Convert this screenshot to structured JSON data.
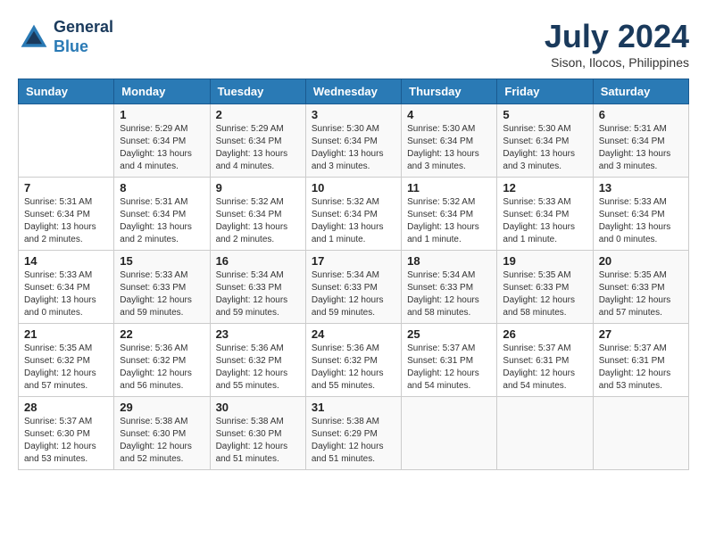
{
  "header": {
    "logo_line1": "General",
    "logo_line2": "Blue",
    "month_title": "July 2024",
    "location": "Sison, Ilocos, Philippines"
  },
  "weekdays": [
    "Sunday",
    "Monday",
    "Tuesday",
    "Wednesday",
    "Thursday",
    "Friday",
    "Saturday"
  ],
  "weeks": [
    [
      {
        "day": "",
        "info": ""
      },
      {
        "day": "1",
        "info": "Sunrise: 5:29 AM\nSunset: 6:34 PM\nDaylight: 13 hours\nand 4 minutes."
      },
      {
        "day": "2",
        "info": "Sunrise: 5:29 AM\nSunset: 6:34 PM\nDaylight: 13 hours\nand 4 minutes."
      },
      {
        "day": "3",
        "info": "Sunrise: 5:30 AM\nSunset: 6:34 PM\nDaylight: 13 hours\nand 3 minutes."
      },
      {
        "day": "4",
        "info": "Sunrise: 5:30 AM\nSunset: 6:34 PM\nDaylight: 13 hours\nand 3 minutes."
      },
      {
        "day": "5",
        "info": "Sunrise: 5:30 AM\nSunset: 6:34 PM\nDaylight: 13 hours\nand 3 minutes."
      },
      {
        "day": "6",
        "info": "Sunrise: 5:31 AM\nSunset: 6:34 PM\nDaylight: 13 hours\nand 3 minutes."
      }
    ],
    [
      {
        "day": "7",
        "info": "Sunrise: 5:31 AM\nSunset: 6:34 PM\nDaylight: 13 hours\nand 2 minutes."
      },
      {
        "day": "8",
        "info": "Sunrise: 5:31 AM\nSunset: 6:34 PM\nDaylight: 13 hours\nand 2 minutes."
      },
      {
        "day": "9",
        "info": "Sunrise: 5:32 AM\nSunset: 6:34 PM\nDaylight: 13 hours\nand 2 minutes."
      },
      {
        "day": "10",
        "info": "Sunrise: 5:32 AM\nSunset: 6:34 PM\nDaylight: 13 hours\nand 1 minute."
      },
      {
        "day": "11",
        "info": "Sunrise: 5:32 AM\nSunset: 6:34 PM\nDaylight: 13 hours\nand 1 minute."
      },
      {
        "day": "12",
        "info": "Sunrise: 5:33 AM\nSunset: 6:34 PM\nDaylight: 13 hours\nand 1 minute."
      },
      {
        "day": "13",
        "info": "Sunrise: 5:33 AM\nSunset: 6:34 PM\nDaylight: 13 hours\nand 0 minutes."
      }
    ],
    [
      {
        "day": "14",
        "info": "Sunrise: 5:33 AM\nSunset: 6:34 PM\nDaylight: 13 hours\nand 0 minutes."
      },
      {
        "day": "15",
        "info": "Sunrise: 5:33 AM\nSunset: 6:33 PM\nDaylight: 12 hours\nand 59 minutes."
      },
      {
        "day": "16",
        "info": "Sunrise: 5:34 AM\nSunset: 6:33 PM\nDaylight: 12 hours\nand 59 minutes."
      },
      {
        "day": "17",
        "info": "Sunrise: 5:34 AM\nSunset: 6:33 PM\nDaylight: 12 hours\nand 59 minutes."
      },
      {
        "day": "18",
        "info": "Sunrise: 5:34 AM\nSunset: 6:33 PM\nDaylight: 12 hours\nand 58 minutes."
      },
      {
        "day": "19",
        "info": "Sunrise: 5:35 AM\nSunset: 6:33 PM\nDaylight: 12 hours\nand 58 minutes."
      },
      {
        "day": "20",
        "info": "Sunrise: 5:35 AM\nSunset: 6:33 PM\nDaylight: 12 hours\nand 57 minutes."
      }
    ],
    [
      {
        "day": "21",
        "info": "Sunrise: 5:35 AM\nSunset: 6:32 PM\nDaylight: 12 hours\nand 57 minutes."
      },
      {
        "day": "22",
        "info": "Sunrise: 5:36 AM\nSunset: 6:32 PM\nDaylight: 12 hours\nand 56 minutes."
      },
      {
        "day": "23",
        "info": "Sunrise: 5:36 AM\nSunset: 6:32 PM\nDaylight: 12 hours\nand 55 minutes."
      },
      {
        "day": "24",
        "info": "Sunrise: 5:36 AM\nSunset: 6:32 PM\nDaylight: 12 hours\nand 55 minutes."
      },
      {
        "day": "25",
        "info": "Sunrise: 5:37 AM\nSunset: 6:31 PM\nDaylight: 12 hours\nand 54 minutes."
      },
      {
        "day": "26",
        "info": "Sunrise: 5:37 AM\nSunset: 6:31 PM\nDaylight: 12 hours\nand 54 minutes."
      },
      {
        "day": "27",
        "info": "Sunrise: 5:37 AM\nSunset: 6:31 PM\nDaylight: 12 hours\nand 53 minutes."
      }
    ],
    [
      {
        "day": "28",
        "info": "Sunrise: 5:37 AM\nSunset: 6:30 PM\nDaylight: 12 hours\nand 53 minutes."
      },
      {
        "day": "29",
        "info": "Sunrise: 5:38 AM\nSunset: 6:30 PM\nDaylight: 12 hours\nand 52 minutes."
      },
      {
        "day": "30",
        "info": "Sunrise: 5:38 AM\nSunset: 6:30 PM\nDaylight: 12 hours\nand 51 minutes."
      },
      {
        "day": "31",
        "info": "Sunrise: 5:38 AM\nSunset: 6:29 PM\nDaylight: 12 hours\nand 51 minutes."
      },
      {
        "day": "",
        "info": ""
      },
      {
        "day": "",
        "info": ""
      },
      {
        "day": "",
        "info": ""
      }
    ]
  ]
}
